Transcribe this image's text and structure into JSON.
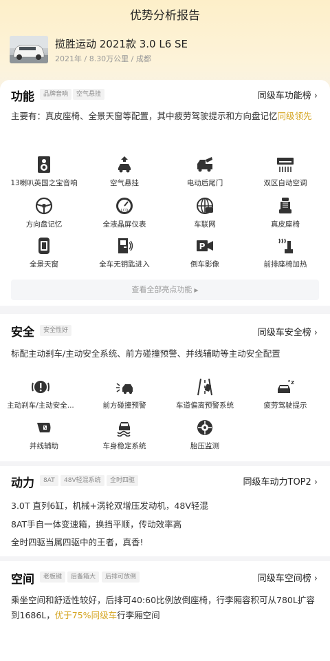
{
  "page": {
    "title": "优势分析报告"
  },
  "car": {
    "name": "揽胜运动 2021款 3.0 L6 SE",
    "meta": "2021年 / 8.30万公里 / 成都"
  },
  "sections": {
    "function": {
      "title": "功能",
      "tags": [
        "品牌音响",
        "空气悬挂"
      ],
      "link": "同级车功能榜",
      "desc_prefix": "主要有：真皮座椅、全景天窗等配置，其中疲劳驾驶提示和方向盘记忆",
      "desc_highlight": "同级领先",
      "features": [
        {
          "label": "13喇叭英国之宝音响",
          "icon": "speaker-icon"
        },
        {
          "label": "空气悬挂",
          "icon": "air-suspension-icon"
        },
        {
          "label": "电动后尾门",
          "icon": "power-tailgate-icon"
        },
        {
          "label": "双区自动空调",
          "icon": "dual-zone-ac-icon"
        },
        {
          "label": "方向盘记忆",
          "icon": "steering-memory-icon"
        },
        {
          "label": "全液晶屏仪表",
          "icon": "lcd-dashboard-icon"
        },
        {
          "label": "车联网",
          "icon": "connected-car-icon"
        },
        {
          "label": "真皮座椅",
          "icon": "leather-seat-icon"
        },
        {
          "label": "全景天窗",
          "icon": "panoramic-sunroof-icon"
        },
        {
          "label": "全车无钥匙进入",
          "icon": "keyless-entry-icon"
        },
        {
          "label": "倒车影像",
          "icon": "reverse-camera-icon"
        },
        {
          "label": "前排座椅加热",
          "icon": "seat-heating-icon"
        }
      ],
      "more": "查看全部亮点功能"
    },
    "safety": {
      "title": "安全",
      "tags": [
        "安全性好"
      ],
      "link": "同级车安全榜",
      "desc": "标配主动刹车/主动安全系统、前方碰撞预警、并线辅助等主动安全配置",
      "features": [
        {
          "label": "主动刹车/主动安全...",
          "icon": "active-brake-icon"
        },
        {
          "label": "前方碰撞预警",
          "icon": "collision-warning-icon"
        },
        {
          "label": "车道偏离预警系统",
          "icon": "lane-departure-icon"
        },
        {
          "label": "疲劳驾驶提示",
          "icon": "fatigue-alert-icon"
        },
        {
          "label": "并线辅助",
          "icon": "blind-spot-icon"
        },
        {
          "label": "车身稳定系统",
          "icon": "stability-control-icon"
        },
        {
          "label": "胎压监测",
          "icon": "tire-pressure-icon"
        }
      ]
    },
    "power": {
      "title": "动力",
      "tags": [
        "8AT",
        "48V轻混系统",
        "全时四驱"
      ],
      "link": "同级车动力TOP2",
      "lines": [
        "3.0T 直列6缸，机械+涡轮双增压发动机，48V轻混",
        "8AT手自一体变速箱，换挡平顺，传动效率高",
        "全时四驱当属四驱中的王者，真香!"
      ]
    },
    "space": {
      "title": "空间",
      "tags": [
        "老板键",
        "后备箱大",
        "后排可放倒"
      ],
      "link": "同级车空间榜",
      "desc_prefix": "乘坐空间和舒适性较好，后排可40:60比例放倒座椅，行李厢容积可从780L扩容到1686L，",
      "desc_highlight": "优于75%同级车",
      "desc_suffix": "行李厢空间"
    }
  },
  "colors": {
    "accent": "#d5a521",
    "hero_top": "#fdefc9",
    "tag_bg": "#f2f2f2"
  }
}
